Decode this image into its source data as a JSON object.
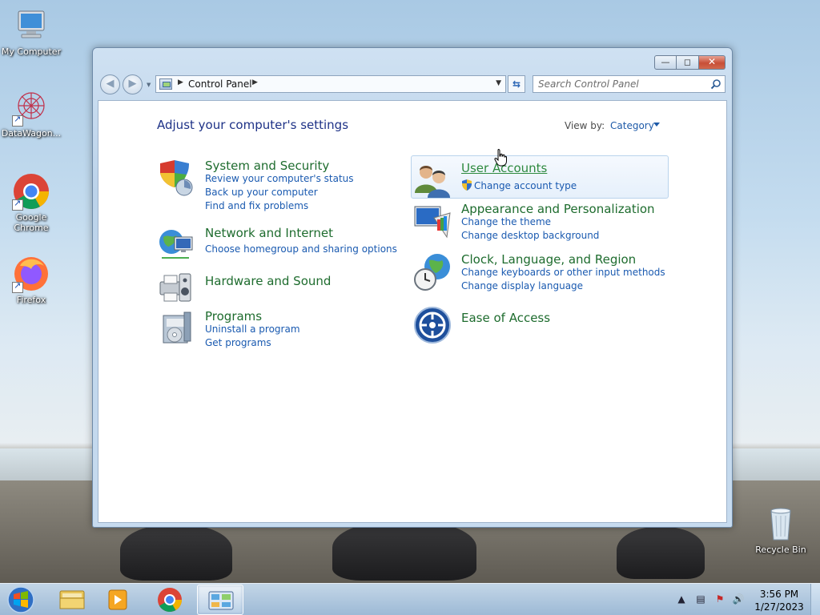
{
  "desktop": {
    "icons": [
      {
        "label": "My Computer"
      },
      {
        "label": "DataWagon..."
      },
      {
        "label": "Google Chrome"
      },
      {
        "label": "Firefox"
      },
      {
        "label": "Recycle Bin"
      }
    ]
  },
  "window": {
    "address": {
      "path": "Control Panel",
      "search_placeholder": "Search Control Panel"
    },
    "content": {
      "heading": "Adjust your computer's settings",
      "view_by_label": "View by:",
      "view_by_value": "Category",
      "categories_left": [
        {
          "title": "System and Security",
          "links": [
            "Review your computer's status",
            "Back up your computer",
            "Find and fix problems"
          ]
        },
        {
          "title": "Network and Internet",
          "links": [
            "Choose homegroup and sharing options"
          ]
        },
        {
          "title": "Hardware and Sound",
          "links": []
        },
        {
          "title": "Programs",
          "links": [
            "Uninstall a program",
            "Get programs"
          ]
        }
      ],
      "categories_right": [
        {
          "title": "User Accounts",
          "links": [
            "Change account type"
          ]
        },
        {
          "title": "Appearance and Personalization",
          "links": [
            "Change the theme",
            "Change desktop background"
          ]
        },
        {
          "title": "Clock, Language, and Region",
          "links": [
            "Change keyboards or other input methods",
            "Change display language"
          ]
        },
        {
          "title": "Ease of Access",
          "links": []
        }
      ]
    }
  },
  "taskbar": {
    "clock_time": "3:56 PM",
    "clock_date": "1/27/2023",
    "pinned": [
      "windows-explorer",
      "media-player",
      "google-chrome",
      "control-panel"
    ]
  },
  "colors": {
    "category_title": "#1e6c2e",
    "link": "#1a5ab0",
    "heading": "#1e3287"
  }
}
